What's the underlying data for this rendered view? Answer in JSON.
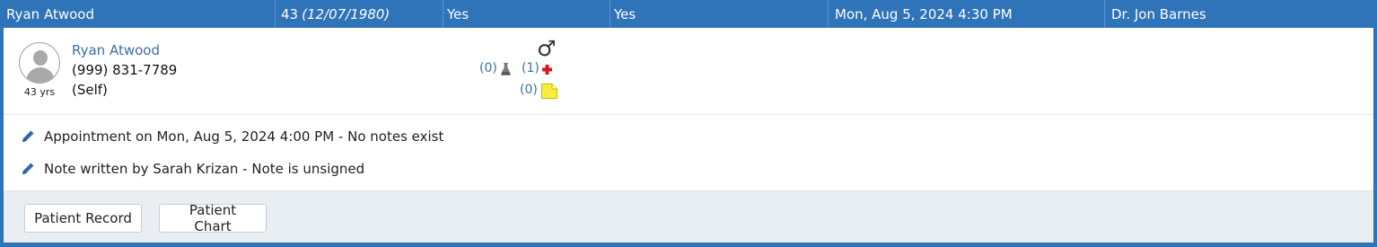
{
  "header": {
    "patient_name": "Ryan Atwood",
    "age": "43",
    "dob": "(12/07/1980)",
    "col3": "Yes",
    "col4": "Yes",
    "appointment_datetime": "Mon, Aug 5, 2024 4:30 PM",
    "provider": "Dr. Jon Barnes"
  },
  "patient": {
    "name": "Ryan Atwood",
    "phone": "(999) 831-7789",
    "relationship": "(Self)",
    "age_label": "43 yrs",
    "gender_icon": "male-symbol-icon"
  },
  "indicators": {
    "labs_count": "(0)",
    "medical_count": "(1)",
    "notes_count": "(0)"
  },
  "activity": [
    {
      "text": "Appointment on Mon, Aug 5, 2024 4:00 PM - No notes exist"
    },
    {
      "text": "Note written by Sarah Krizan - Note is unsigned"
    }
  ],
  "buttons": {
    "patient_record": "Patient Record",
    "patient_chart": "Patient Chart"
  },
  "colors": {
    "header_bg": "#2f73b8",
    "link": "#3a6fa6",
    "footer_bg": "#e9eef3",
    "cross": "#d9151b",
    "sticky_note": "#f6ee3f"
  }
}
